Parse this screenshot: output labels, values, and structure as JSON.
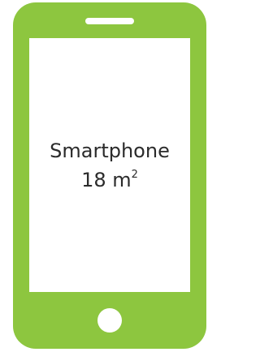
{
  "colors": {
    "phone_body": "#8dc63f",
    "screen": "#ffffff",
    "text": "#2b2b2b"
  },
  "icons": {
    "device": "smartphone-icon",
    "speaker": "speaker-slot-icon",
    "home": "home-button-icon"
  },
  "screen": {
    "label": "Smartphone",
    "area_value": "18 m",
    "area_unit_superscript": "2"
  }
}
